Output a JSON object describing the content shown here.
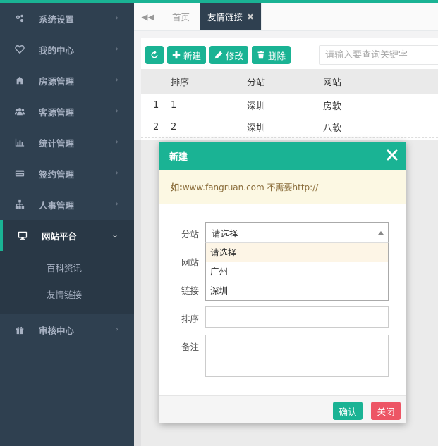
{
  "sidebar": {
    "items": [
      {
        "label": "系统设置",
        "icon": "gears-icon"
      },
      {
        "label": "我的中心",
        "icon": "heart-icon"
      },
      {
        "label": "房源管理",
        "icon": "home-icon"
      },
      {
        "label": "客源管理",
        "icon": "users-icon"
      },
      {
        "label": "统计管理",
        "icon": "bar-chart-icon"
      },
      {
        "label": "签约管理",
        "icon": "credit-card-icon"
      },
      {
        "label": "人事管理",
        "icon": "sitemap-icon"
      },
      {
        "label": "网站平台",
        "icon": "desktop-icon",
        "active": true
      }
    ],
    "subitems": [
      "百科资讯",
      "友情链接"
    ],
    "last_item": {
      "label": "审核中心",
      "icon": "gift-icon"
    }
  },
  "tabs": {
    "home": "首页",
    "current": "友情链接",
    "close_glyph": "✖"
  },
  "toolbar": {
    "new_label": "新建",
    "edit_label": "修改",
    "delete_label": "删除",
    "search_placeholder": "请输入要查询关键字"
  },
  "table": {
    "headers": [
      "排序",
      "分站",
      "网站"
    ],
    "rows": [
      {
        "idx": "1",
        "order": "1",
        "branch": "深圳",
        "site": "房软"
      },
      {
        "idx": "2",
        "order": "2",
        "branch": "深圳",
        "site": "八软"
      }
    ]
  },
  "modal": {
    "title": "新建",
    "tip_bold": "如:",
    "tip_text": "www.fangruan.com 不需要http://",
    "labels": {
      "branch": "分站",
      "site": "网站",
      "link": "链接",
      "order": "排序",
      "note": "备注"
    },
    "select_value": "请选择",
    "options": [
      "请选择",
      "广州",
      "深圳"
    ],
    "ok_label": "确认",
    "close_label": "关闭"
  },
  "colors": {
    "accent": "#1ab394",
    "sidebar": "#2f4050",
    "danger": "#ed5565"
  }
}
